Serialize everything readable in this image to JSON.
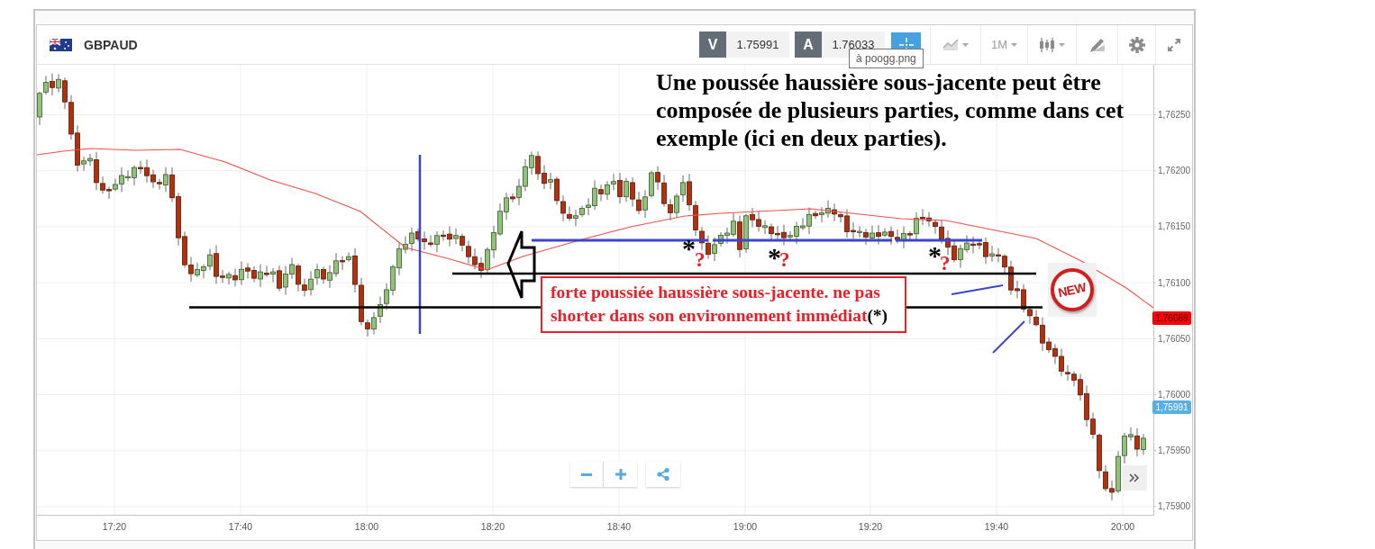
{
  "header": {
    "symbol": "GBPAUD",
    "sell": {
      "label": "V",
      "price": "1.75991"
    },
    "buy": {
      "label": "A",
      "price": "1.76033"
    },
    "crosshair_on": true,
    "timeframe": "1M"
  },
  "tooltip": "à poogg.png",
  "chart": {
    "y_ticks": [
      "1,76250",
      "1,76200",
      "1,76150",
      "1,76100",
      "1,76050",
      "1,76000",
      "1,75950",
      "1,75900"
    ],
    "x_ticks": [
      "17:20",
      "17:40",
      "18:00",
      "18:20",
      "18:40",
      "19:00",
      "19:20",
      "19:40",
      "20:00"
    ],
    "price_labels": [
      {
        "text": "1,76069",
        "color": "#ff0000"
      },
      {
        "text": "1,75991",
        "color": "#5aafe2"
      }
    ]
  },
  "annotations": {
    "heading": "Une poussée haussière sous-jacente peut être composée de plusieurs parties, comme dans cet exemple (ici en deux parties).",
    "note": {
      "text": "forte poussiée haussière sous-jacente. ne pas shorter dans son environnement immédiat",
      "marker": "(*)"
    },
    "flags": [
      {
        "star": "*",
        "question": "?"
      },
      {
        "star": "*",
        "question": "?"
      },
      {
        "star": "*",
        "question": "?"
      }
    ],
    "sticker": "NEW"
  }
}
